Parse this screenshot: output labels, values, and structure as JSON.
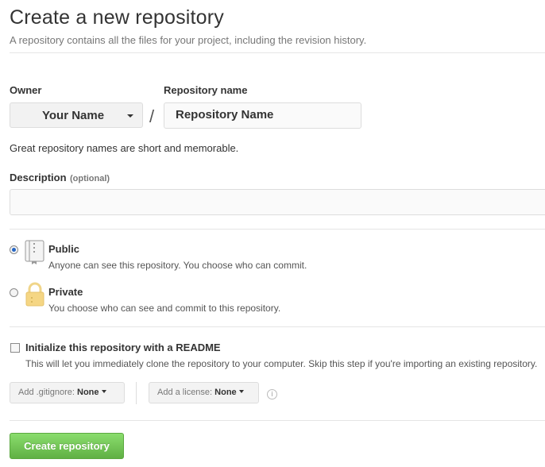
{
  "page": {
    "title": "Create a new repository",
    "subtitle": "A repository contains all the files for your project, including the revision history."
  },
  "owner": {
    "label": "Owner",
    "value": "Your Name"
  },
  "separator": "/",
  "repository": {
    "label": "Repository name",
    "value": "Repository Name",
    "hint": "Great repository names are short and memorable."
  },
  "description": {
    "label": "Description",
    "optional": "(optional)",
    "value": ""
  },
  "visibility": {
    "public": {
      "title": "Public",
      "desc": "Anyone can see this repository. You choose who can commit.",
      "selected": true
    },
    "private": {
      "title": "Private",
      "desc": "You choose who can see and commit to this repository.",
      "selected": false
    }
  },
  "readme": {
    "label": "Initialize this repository with a README",
    "desc": "This will let you immediately clone the repository to your computer. Skip this step if you're importing an existing repository.",
    "checked": false
  },
  "gitignore": {
    "prefix": "Add .gitignore:",
    "value": "None"
  },
  "license": {
    "prefix": "Add a license:",
    "value": "None"
  },
  "info_glyph": "i",
  "submit": {
    "label": "Create repository"
  },
  "colors": {
    "accent_green": "#60b044",
    "radio_blue": "#2566c4",
    "lock_yellow": "#f5d684"
  }
}
